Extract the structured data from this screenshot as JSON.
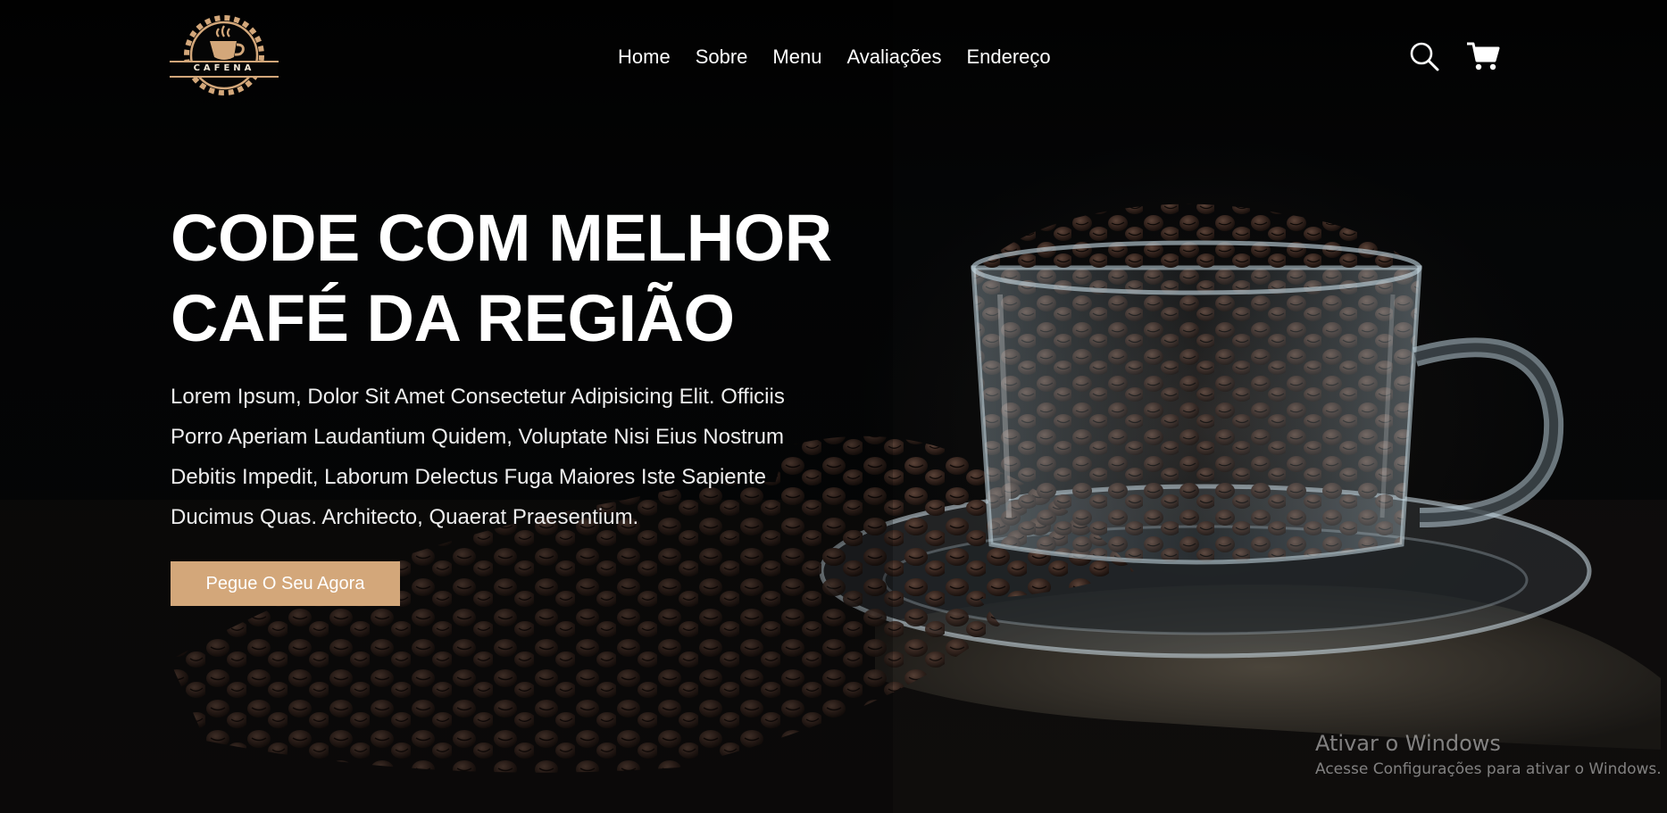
{
  "brand": {
    "logo_text": "CAFENA",
    "accent_color": "#d3a77a"
  },
  "nav": {
    "items": [
      {
        "label": "Home"
      },
      {
        "label": "Sobre"
      },
      {
        "label": "Menu"
      },
      {
        "label": "Avaliações"
      },
      {
        "label": "Endereço"
      }
    ]
  },
  "header_icons": {
    "search": "search-icon",
    "cart": "shopping-cart-icon"
  },
  "hero": {
    "title_line1": "CODE COM MELHOR",
    "title_line2": "CAFÉ DA REGIÃO",
    "description": "Lorem Ipsum, Dolor Sit Amet Consectetur Adipisicing Elit. Officiis Porro Aperiam Laudantium Quidem, Voluptate Nisi Eius Nostrum Debitis Impedit, Laborum Delectus Fuga Maiores Iste Sapiente Ducimus Quas. Architecto, Quaerat Praesentium.",
    "cta_label": "Pegue O Seu Agora",
    "background_image": "coffee-beans-glass-cup-photo"
  },
  "watermark": {
    "title": "Ativar o Windows",
    "subtitle": "Acesse Configurações para ativar o Windows."
  }
}
